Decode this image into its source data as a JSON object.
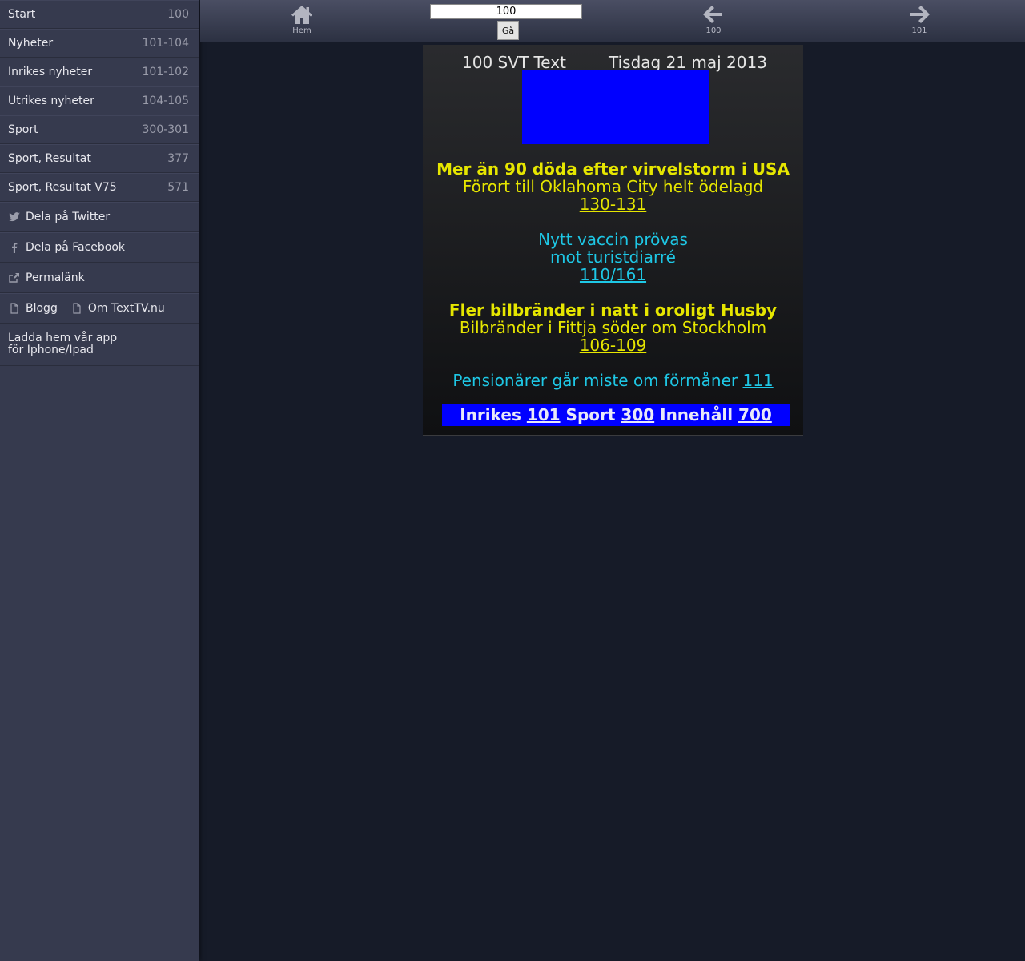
{
  "sidebar": {
    "items": [
      {
        "label": "Start",
        "num": "100"
      },
      {
        "label": "Nyheter",
        "num": "101-104"
      },
      {
        "label": "Inrikes nyheter",
        "num": "101-102"
      },
      {
        "label": "Utrikes nyheter",
        "num": "104-105"
      },
      {
        "label": "Sport",
        "num": "300-301"
      },
      {
        "label": "Sport, Resultat",
        "num": "377"
      },
      {
        "label": "Sport, Resultat V75",
        "num": "571"
      }
    ],
    "share_twitter": "Dela på Twitter",
    "share_facebook": "Dela på Facebook",
    "permalink": "Permalänk",
    "blog": "Blogg",
    "about": "Om TextTV.nu",
    "app_line1": "Ladda hem vår app",
    "app_line2": "för Iphone/Ipad"
  },
  "topbar": {
    "home_label": "Hem",
    "prev_label": "100",
    "next_label": "101",
    "page_input_value": "100",
    "go_label": "Gå"
  },
  "page": {
    "header_left": "100 SVT Text",
    "header_right": "Tisdag 21 maj 2013",
    "news": [
      {
        "headline": "Mer än 90 döda efter virvelstorm i USA",
        "sub": "Förort till Oklahoma City helt ödelagd",
        "link": "130-131"
      },
      {
        "line1": "Nytt vaccin prövas",
        "line2": "mot turistdiarré",
        "link": "110/161"
      },
      {
        "headline": "Fler bilbränder i natt i oroligt Husby",
        "sub": "Bilbränder i Fittja söder om Stockholm",
        "link": "106-109"
      },
      {
        "text": "Pensionärer går miste om förmåner",
        "link": "111"
      }
    ],
    "footer": {
      "inrikes": "Inrikes",
      "inrikes_num": "101",
      "sport": "Sport",
      "sport_num": "300",
      "innehall": "Innehåll",
      "innehall_num": "700"
    }
  },
  "colors": {
    "teletext_yellow": "#e6e600",
    "teletext_cyan": "#1ec8e6",
    "teletext_blue": "#0000ff"
  }
}
